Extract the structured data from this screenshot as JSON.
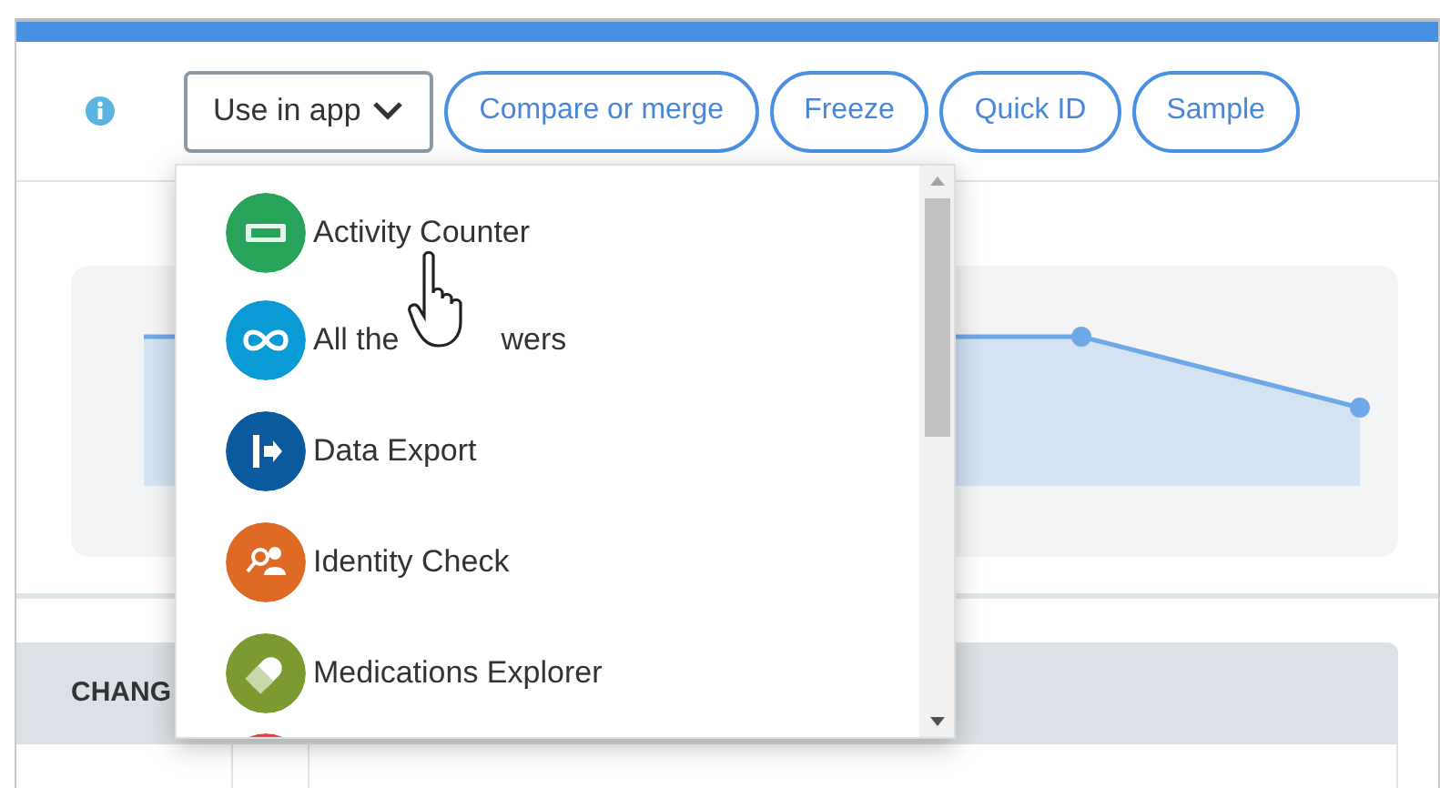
{
  "toolbar": {
    "dropdown": {
      "label": "Use in app",
      "expanded": true
    },
    "buttons": [
      "Compare or merge",
      "Freeze",
      "Quick ID",
      "Sample"
    ]
  },
  "app_menu": {
    "items": [
      {
        "label": "Activity Counter",
        "color": "#27a35a"
      },
      {
        "label": "All the",
        "label_after_cursor": "wers",
        "color": "#0a9ad6"
      },
      {
        "label": "Data Export",
        "color": "#0b5a9e"
      },
      {
        "label": "Identity Check",
        "color": "#de6a26"
      },
      {
        "label": "Medications Explorer",
        "color": "#7c9a30"
      },
      {
        "color": "#e5473a"
      }
    ]
  },
  "table": {
    "columns": [
      "CHANG"
    ]
  }
}
